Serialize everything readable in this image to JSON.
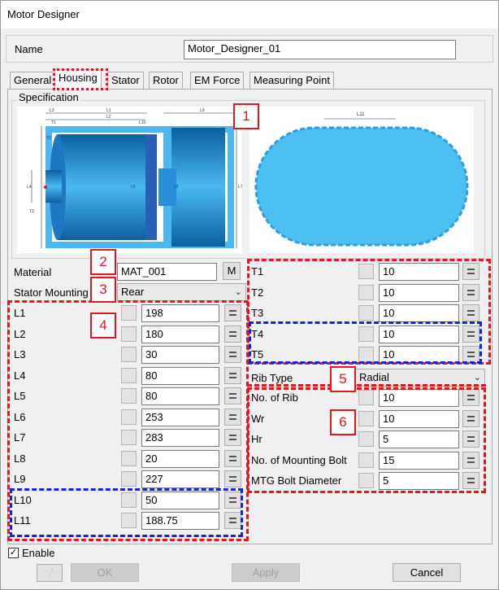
{
  "window": {
    "title": "Motor Designer"
  },
  "name": {
    "label": "Name",
    "value": "Motor_Designer_01"
  },
  "tabs": [
    {
      "label": "General"
    },
    {
      "label": "Housing"
    },
    {
      "label": "Stator"
    },
    {
      "label": "Rotor"
    },
    {
      "label": "EM Force"
    },
    {
      "label": "Measuring Point"
    }
  ],
  "specification": {
    "label": "Specification"
  },
  "drawing": {
    "dims_left": [
      "L3",
      "L1",
      "L2",
      "T1",
      "T2",
      "L10",
      "L4",
      "L6",
      "L5",
      "L9",
      "L7",
      "T3"
    ],
    "dims_right": [
      "L11"
    ]
  },
  "material": {
    "label": "Material",
    "value": "MAT_001",
    "button": "M"
  },
  "stator_mounting": {
    "label": "Stator Mounting",
    "value": "Rear"
  },
  "left_params": [
    {
      "label": "L1",
      "value": "198"
    },
    {
      "label": "L2",
      "value": "180"
    },
    {
      "label": "L3",
      "value": "30"
    },
    {
      "label": "L4",
      "value": "80"
    },
    {
      "label": "L5",
      "value": "80"
    },
    {
      "label": "L6",
      "value": "253"
    },
    {
      "label": "L7",
      "value": "283"
    },
    {
      "label": "L8",
      "value": "20"
    },
    {
      "label": "L9",
      "value": "227"
    },
    {
      "label": "L10",
      "value": "50"
    },
    {
      "label": "L11",
      "value": "188.75"
    }
  ],
  "right_params": [
    {
      "label": "T1",
      "value": "10"
    },
    {
      "label": "T2",
      "value": "10"
    },
    {
      "label": "T3",
      "value": "10"
    },
    {
      "label": "T4",
      "value": "10"
    },
    {
      "label": "T5",
      "value": "10"
    }
  ],
  "rib_type": {
    "label": "Rib Type",
    "value": "Radial"
  },
  "rib_params": [
    {
      "label": "No. of Rib",
      "value": "10"
    },
    {
      "label": "Wr",
      "value": "10"
    },
    {
      "label": "Hr",
      "value": "5"
    },
    {
      "label": "No. of Mounting Bolt",
      "value": "15"
    },
    {
      "label": "MTG Bolt Diameter",
      "value": "5"
    }
  ],
  "badges": [
    "1",
    "2",
    "3",
    "4",
    "5",
    "6"
  ],
  "enable": {
    "label": "Enable",
    "checked": true
  },
  "buttons": {
    "ok": "OK",
    "apply": "Apply",
    "cancel": "Cancel"
  },
  "colors": {
    "housing_blue": "#4db8ef",
    "dark_blue": "#1a8fd6",
    "dash_red": "#e8141e",
    "dash_blue": "#1524d8"
  }
}
